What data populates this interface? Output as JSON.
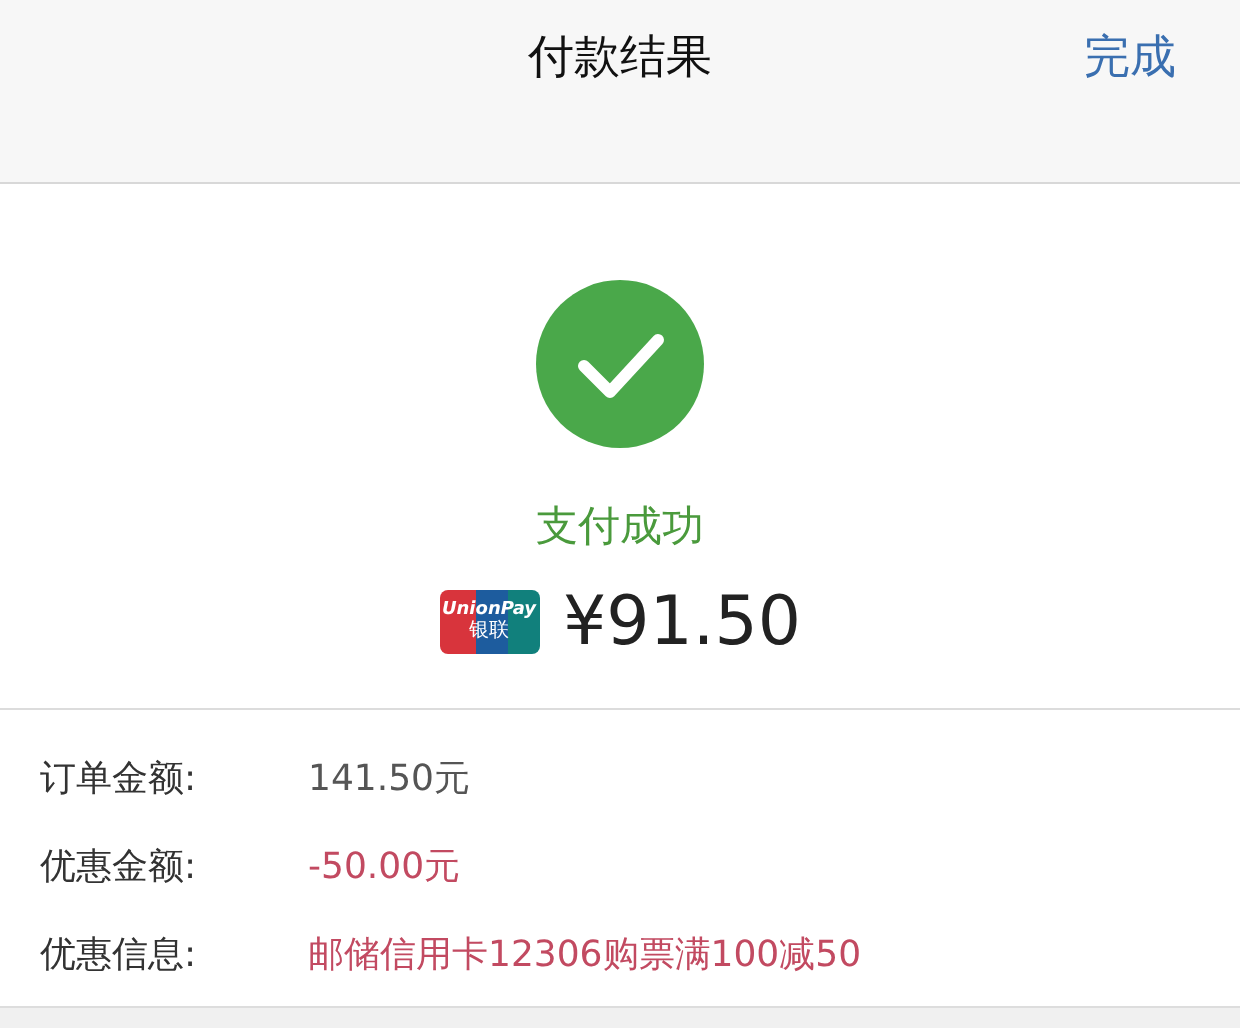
{
  "nav_bar": {
    "title": "付款结果",
    "done_button": "完成"
  },
  "result": {
    "status": "支付成功",
    "card_logo": {
      "line_1": "UnionPay",
      "line_2": "银联"
    },
    "amount": "¥91.50"
  },
  "details": [
    {
      "label": "订单金额:",
      "value": "141.50元",
      "kind": "normal"
    },
    {
      "label": "优惠金额:",
      "value": "-50.00元",
      "kind": "discount"
    },
    {
      "label": "优惠信息:",
      "value": "邮储信用卡12306购票满100减50",
      "kind": "discount"
    }
  ]
}
